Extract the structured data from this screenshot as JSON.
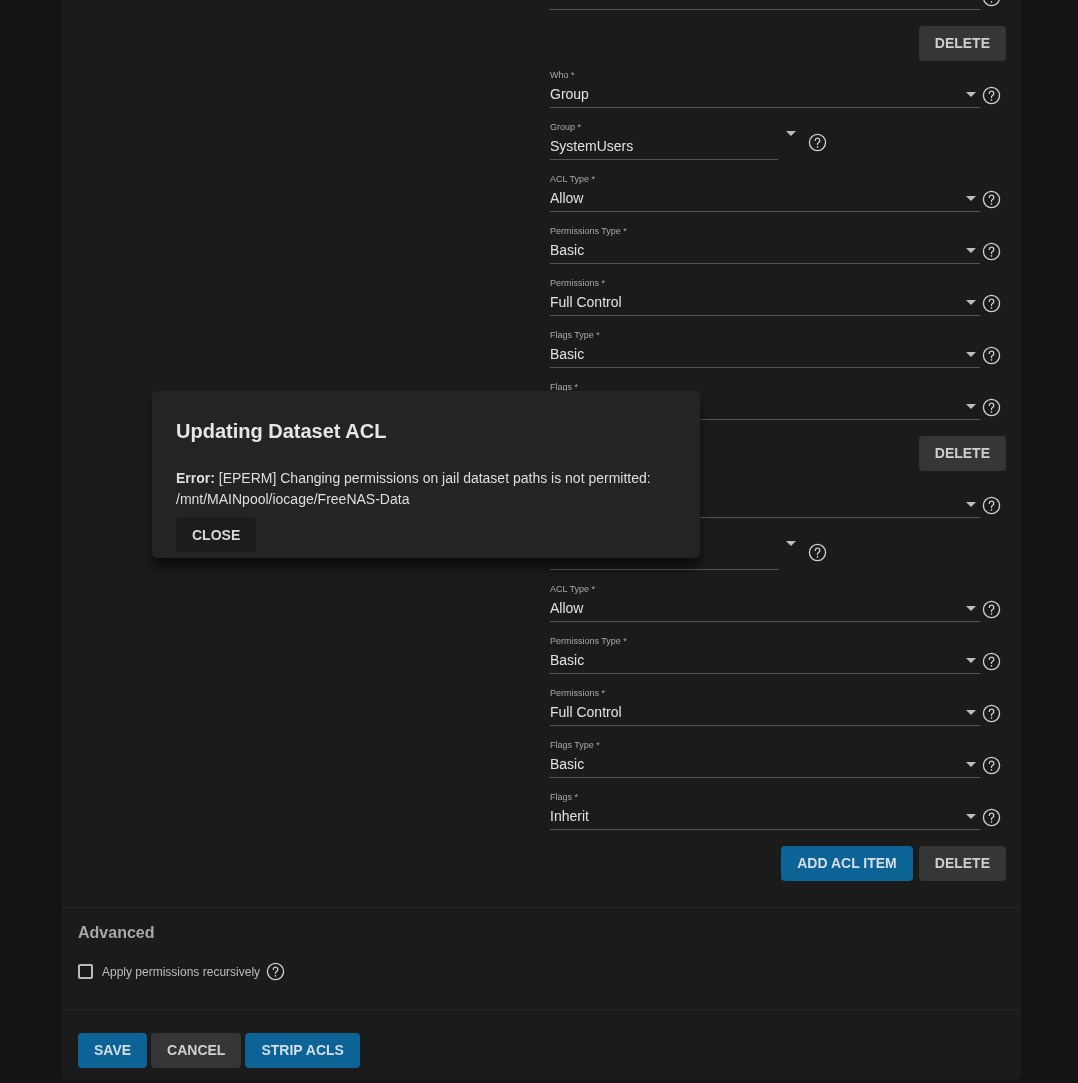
{
  "acl_items": [
    {
      "fields": [
        {
          "kind": "select"
        }
      ],
      "buttons": [
        {
          "kind": "secondary",
          "label": "DELETE"
        }
      ]
    },
    {
      "fields": [
        {
          "kind": "select",
          "label": "Who *",
          "value": "Group"
        },
        {
          "kind": "combo",
          "label": "Group *",
          "value": "SystemUsers"
        },
        {
          "kind": "select",
          "label": "ACL Type *",
          "value": "Allow"
        },
        {
          "kind": "select",
          "label": "Permissions Type *",
          "value": "Basic"
        },
        {
          "kind": "select",
          "label": "Permissions *",
          "value": "Full Control"
        },
        {
          "kind": "select",
          "label": "Flags Type *",
          "value": "Basic"
        },
        {
          "kind": "select",
          "label": "Flags *"
        }
      ],
      "buttons": [
        {
          "kind": "secondary",
          "label": "DELETE"
        }
      ]
    },
    {
      "fields": [
        {
          "kind": "select"
        },
        {
          "kind": "combo"
        },
        {
          "kind": "select",
          "label": "ACL Type *",
          "value": "Allow"
        },
        {
          "kind": "select",
          "label": "Permissions Type *",
          "value": "Basic"
        },
        {
          "kind": "select",
          "label": "Permissions *",
          "value": "Full Control"
        },
        {
          "kind": "select",
          "label": "Flags Type *",
          "value": "Basic"
        },
        {
          "kind": "select",
          "label": "Flags *",
          "value": "Inherit"
        }
      ],
      "buttons": [
        {
          "kind": "primary",
          "label": "ADD ACL ITEM"
        },
        {
          "kind": "secondary",
          "label": "DELETE"
        }
      ]
    }
  ],
  "advanced": {
    "title": "Advanced",
    "recursive": {
      "label": "Apply permissions recursively",
      "checked": false
    }
  },
  "actions": [
    {
      "kind": "primary",
      "label": "SAVE"
    },
    {
      "kind": "secondary",
      "label": "CANCEL"
    },
    {
      "kind": "primary",
      "label": "STRIP ACLS"
    }
  ],
  "dialog": {
    "title": "Updating Dataset ACL",
    "message": "**Error:** [EPERM] Changing permissions on jail dataset paths is not permitted: /mnt/MAINpool/iocage/FreeNAS-Data",
    "button": "CLOSE"
  }
}
